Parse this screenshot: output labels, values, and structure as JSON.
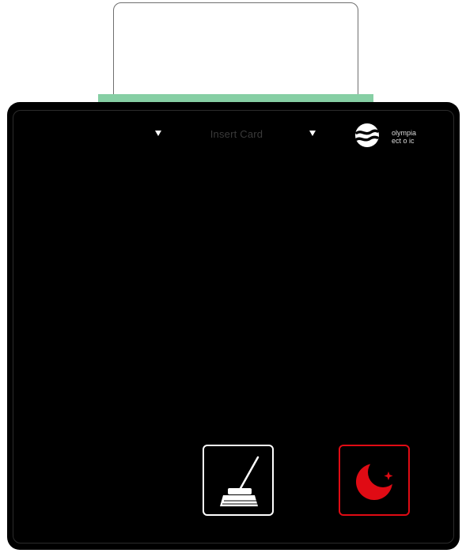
{
  "device": {
    "insert_label": "Insert Card",
    "logo": {
      "line1": "olympia",
      "line2": "ect o ic"
    },
    "colors": {
      "panel": "#000000",
      "slot": "#86cfa4",
      "night_accent": "#e00b14",
      "clean_accent": "#ffffff"
    },
    "buttons": [
      {
        "name": "clean-room-button",
        "icon": "broom-icon"
      },
      {
        "name": "do-not-disturb-button",
        "icon": "crescent-moon-icon"
      }
    ]
  }
}
